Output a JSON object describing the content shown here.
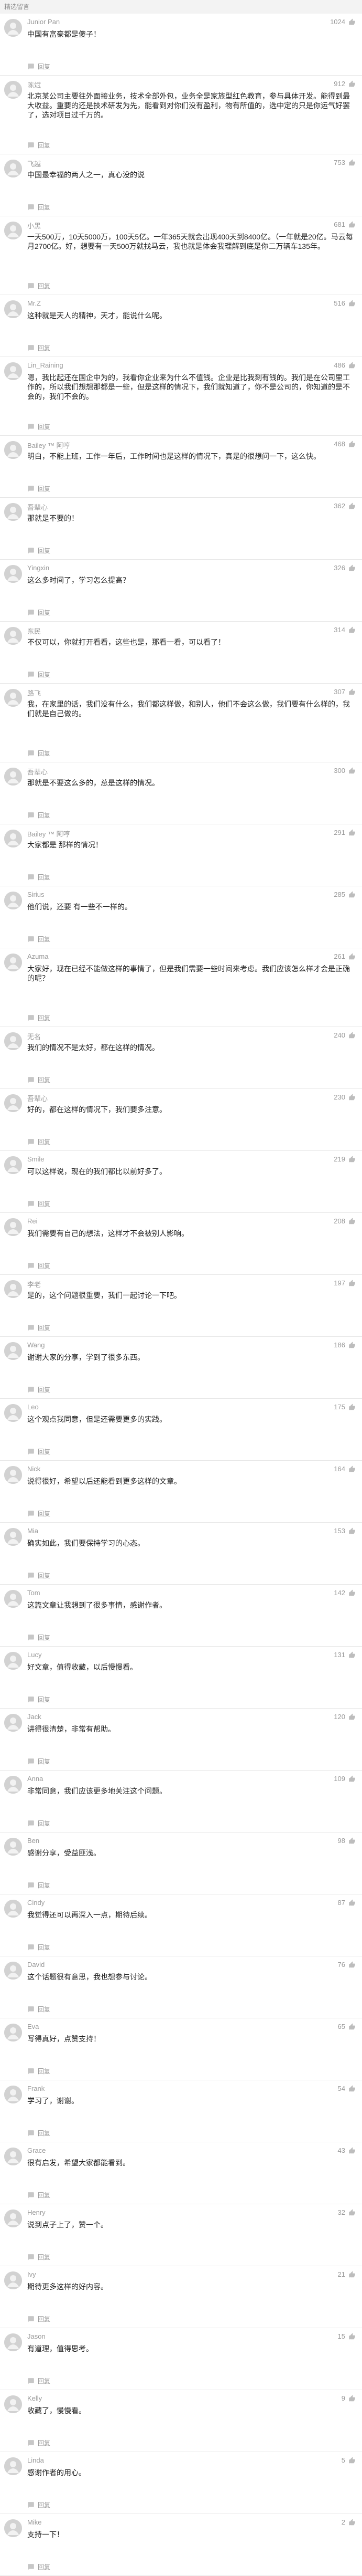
{
  "section_title": "精选留言",
  "reply_label": "回复",
  "colors": {
    "background": "#f3f3f3",
    "card": "#ffffff",
    "muted": "#999999"
  },
  "comments": [
    {
      "user": "Junior Pan",
      "likes": "1024",
      "text": "中国有富豪都是傻子！",
      "meta": "回复",
      "tall": false
    },
    {
      "user": "陈斌",
      "likes": "912",
      "text": "北京某公司主要往外面接业务，技术全部外包，业务全是家族型红色教育，参与具体开发。能得到最大收益。重要的还是技术研发为先，能看到对你们没有盈利，物有所值的，选中定的只是你运气好罢了，选对项目过千万的。",
      "meta": "回复",
      "tall": true
    },
    {
      "user": "飞越",
      "likes": "753",
      "text": "中国最幸福的两人之一，真心没的说",
      "meta": "回复",
      "tall": false
    },
    {
      "user": "小黑",
      "likes": "681",
      "text": "一天500万，10天5000万，100天5亿。一年365天就会出现400天到8400亿。（一年就是20亿。马云每月2700亿。好，想要有一天500万就找马云，我也就是体会我理解到底是你二万辆车135年。",
      "meta": "回复",
      "tall": true
    },
    {
      "user": "Mr.Z",
      "likes": "516",
      "text": "这种就是天人的精神，天才，能说什么呢。",
      "meta": "回复",
      "tall": false
    },
    {
      "user": "Lin_Raining",
      "likes": "486",
      "text": "嗯，我比起还在国企中为的，我看你企业来为什么不值钱。企业是比我刻有钱的。我们是在公司里工作的，所以我们想想那都是一些，但是这样的情况下，我们就知道了，你不是公司的，你知道的是不会的，我们不会的。",
      "meta": "回复",
      "tall": true
    },
    {
      "user": "Bailey ™ 阿哼",
      "likes": "468",
      "text": "明白，不能上班，工作一年后，工作时间也是这样的情况下，真是的很想问一下，这么快。",
      "meta": "回复",
      "tall": false
    },
    {
      "user": "吾辈心",
      "likes": "362",
      "text": "那就是不要的！",
      "meta": "回复",
      "tall": false
    },
    {
      "user": "Yingxin",
      "likes": "326",
      "text": "这么多时间了，学习怎么提高？",
      "meta": "回复",
      "tall": false
    },
    {
      "user": "东民",
      "likes": "314",
      "text": "不仅可以，你就打开看看，这些也是，那看一看，可以看了！",
      "meta": "回复",
      "tall": false
    },
    {
      "user": "路飞",
      "likes": "307",
      "text": "我，在家里的话，我们没有什么，我们都这样做，和别人，他们不会这么做，我们要有什么样的，我们就是自己做的。",
      "meta": "回复",
      "tall": true
    },
    {
      "user": "吾辈心",
      "likes": "300",
      "text": "那就是不要这么多的，总是这样的情况。",
      "meta": "回复",
      "tall": false
    },
    {
      "user": "Bailey ™ 阿哼",
      "likes": "291",
      "text": "大家都是 那样的情况！",
      "meta": "回复",
      "tall": false
    },
    {
      "user": "Sirius",
      "likes": "285",
      "text": "他们说，还要 有一些不一样的。",
      "meta": "回复",
      "tall": false
    },
    {
      "user": "Azuma",
      "likes": "261",
      "text": "大家好，现在已经不能做这样的事情了，但是我们需要一些时间来考虑。我们应该怎么样才会是正确的呢？",
      "meta": "回复",
      "tall": true
    },
    {
      "user": "无名",
      "likes": "240",
      "text": "我们的情况不是太好，都在这样的情况。",
      "meta": "回复",
      "tall": false
    },
    {
      "user": "吾辈心",
      "likes": "230",
      "text": "好的，都在这样的情况下，我们要多注意。",
      "meta": "回复",
      "tall": false
    },
    {
      "user": "Smile",
      "likes": "219",
      "text": "可以这样说，现在的我们都比以前好多了。",
      "meta": "回复",
      "tall": false
    },
    {
      "user": "Rei",
      "likes": "208",
      "text": "我们需要有自己的想法，这样才不会被别人影响。",
      "meta": "回复",
      "tall": false
    },
    {
      "user": "李老",
      "likes": "197",
      "text": "是的，这个问题很重要，我们一起讨论一下吧。",
      "meta": "回复",
      "tall": false
    },
    {
      "user": "Wang",
      "likes": "186",
      "text": "谢谢大家的分享，学到了很多东西。",
      "meta": "回复",
      "tall": false
    },
    {
      "user": "Leo",
      "likes": "175",
      "text": "这个观点我同意，但是还需要更多的实践。",
      "meta": "回复",
      "tall": false
    },
    {
      "user": "Nick",
      "likes": "164",
      "text": "说得很好，希望以后还能看到更多这样的文章。",
      "meta": "回复",
      "tall": false
    },
    {
      "user": "Mia",
      "likes": "153",
      "text": "确实如此，我们要保持学习的心态。",
      "meta": "回复",
      "tall": false
    },
    {
      "user": "Tom",
      "likes": "142",
      "text": "这篇文章让我想到了很多事情，感谢作者。",
      "meta": "回复",
      "tall": false
    },
    {
      "user": "Lucy",
      "likes": "131",
      "text": "好文章，值得收藏，以后慢慢看。",
      "meta": "回复",
      "tall": false
    },
    {
      "user": "Jack",
      "likes": "120",
      "text": "讲得很清楚，非常有帮助。",
      "meta": "回复",
      "tall": false
    },
    {
      "user": "Anna",
      "likes": "109",
      "text": "非常同意，我们应该更多地关注这个问题。",
      "meta": "回复",
      "tall": false
    },
    {
      "user": "Ben",
      "likes": "98",
      "text": "感谢分享，受益匪浅。",
      "meta": "回复",
      "tall": false
    },
    {
      "user": "Cindy",
      "likes": "87",
      "text": "我觉得还可以再深入一点，期待后续。",
      "meta": "回复",
      "tall": false
    },
    {
      "user": "David",
      "likes": "76",
      "text": "这个话题很有意思，我也想参与讨论。",
      "meta": "回复",
      "tall": false
    },
    {
      "user": "Eva",
      "likes": "65",
      "text": "写得真好，点赞支持！",
      "meta": "回复",
      "tall": false
    },
    {
      "user": "Frank",
      "likes": "54",
      "text": "学习了，谢谢。",
      "meta": "回复",
      "tall": false
    },
    {
      "user": "Grace",
      "likes": "43",
      "text": "很有启发，希望大家都能看到。",
      "meta": "回复",
      "tall": false
    },
    {
      "user": "Henry",
      "likes": "32",
      "text": "说到点子上了，赞一个。",
      "meta": "回复",
      "tall": false
    },
    {
      "user": "Ivy",
      "likes": "21",
      "text": "期待更多这样的好内容。",
      "meta": "回复",
      "tall": false
    },
    {
      "user": "Jason",
      "likes": "15",
      "text": "有道理，值得思考。",
      "meta": "回复",
      "tall": false
    },
    {
      "user": "Kelly",
      "likes": "9",
      "text": "收藏了，慢慢看。",
      "meta": "回复",
      "tall": false
    },
    {
      "user": "Linda",
      "likes": "5",
      "text": "感谢作者的用心。",
      "meta": "回复",
      "tall": false
    },
    {
      "user": "Mike",
      "likes": "2",
      "text": "支持一下！",
      "meta": "回复",
      "tall": false
    }
  ]
}
